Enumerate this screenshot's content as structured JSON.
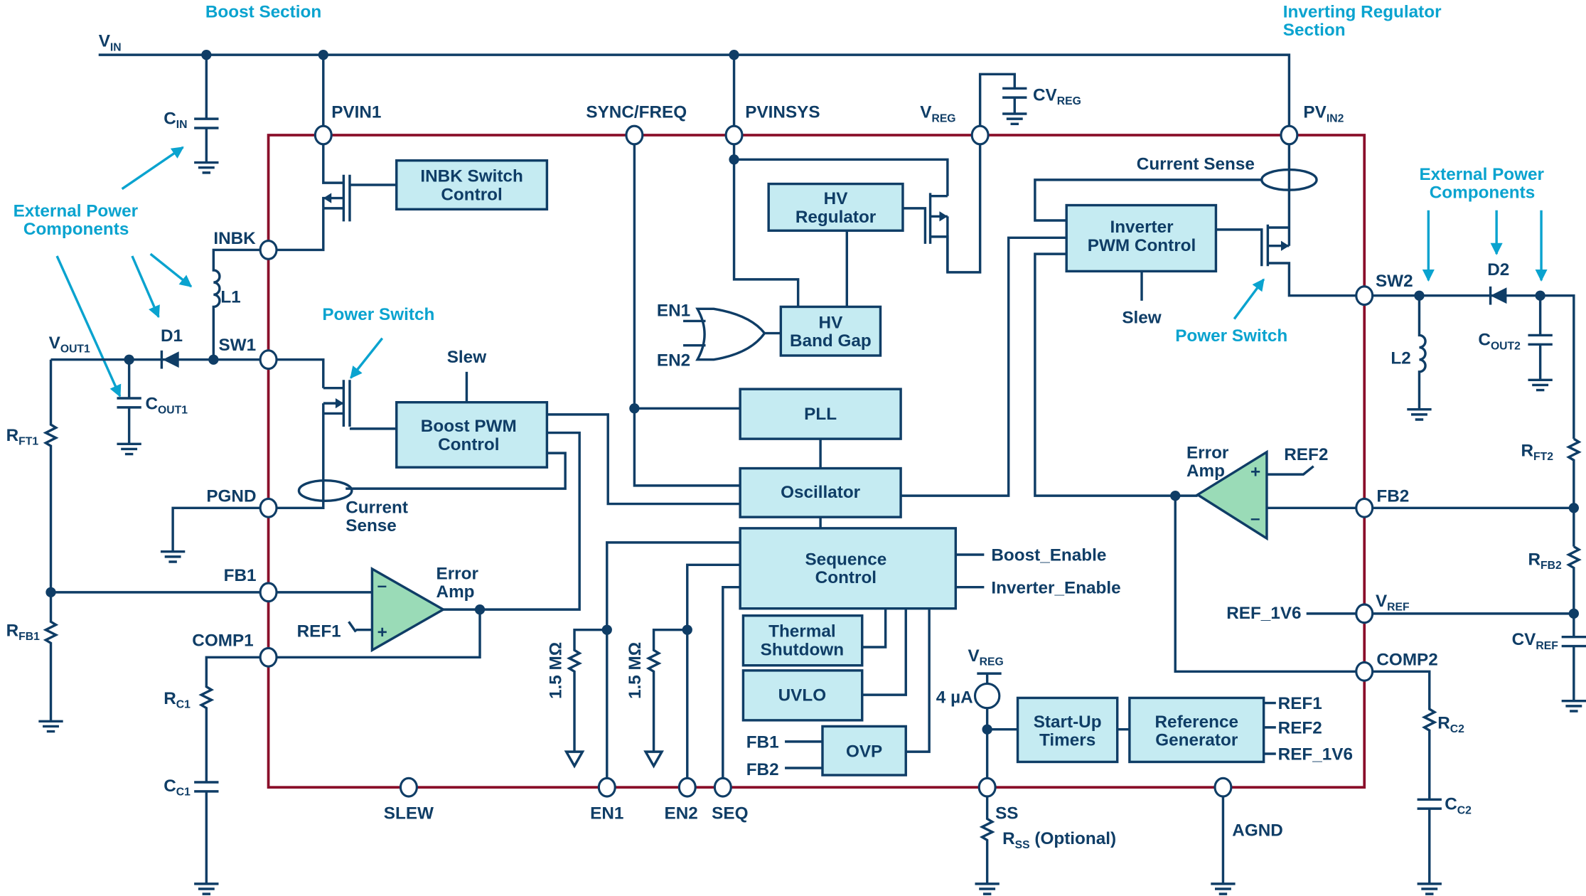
{
  "sections": {
    "boost": "Boost Section",
    "inverting_line1": "Inverting Regulator",
    "inverting_line2": "Section"
  },
  "annotations": {
    "ext_power_left_1": "External Power",
    "ext_power_left_2": "Components",
    "ext_power_right_1": "External Power",
    "ext_power_right_2": "Components",
    "power_switch_left": "Power Switch",
    "power_switch_right": "Power Switch"
  },
  "pins": {
    "pvin1": "PVIN1",
    "sync_freq": "SYNC/FREQ",
    "pvinsys": "PVINSYS",
    "vreg_main": "V",
    "vreg_sub": "REG",
    "pvin2_main": "PV",
    "pvin2_sub": "IN2",
    "inbk": "INBK",
    "sw1": "SW1",
    "pgnd": "PGND",
    "fb1": "FB1",
    "comp1": "COMP1",
    "slew": "SLEW",
    "en1": "EN1",
    "en2": "EN2",
    "seq": "SEQ",
    "ss": "SS",
    "agnd": "AGND",
    "sw2": "SW2",
    "fb2": "FB2",
    "vref_main": "V",
    "vref_sub": "REF",
    "comp2": "COMP2"
  },
  "blocks": {
    "inbk_switch_1": "INBK Switch",
    "inbk_switch_2": "Control",
    "hv_reg_1": "HV",
    "hv_reg_2": "Regulator",
    "hv_bandgap_1": "HV",
    "hv_bandgap_2": "Band Gap",
    "inverter_pwm_1": "Inverter",
    "inverter_pwm_2": "PWM Control",
    "boost_pwm_1": "Boost PWM",
    "boost_pwm_2": "Control",
    "pll": "PLL",
    "oscillator": "Oscillator",
    "sequence_1": "Sequence",
    "sequence_2": "Control",
    "thermal_1": "Thermal",
    "thermal_2": "Shutdown",
    "uvlo": "UVLO",
    "ovp": "OVP",
    "startup_1": "Start-Up",
    "startup_2": "Timers",
    "refgen_1": "Reference",
    "refgen_2": "Generator"
  },
  "labels": {
    "vin_main": "V",
    "vin_sub": "IN",
    "cin_main": "C",
    "cin_sub": "IN",
    "cvreg_main": "CV",
    "cvreg_sub": "REG",
    "l1": "L1",
    "d1": "D1",
    "vout1_main": "V",
    "vout1_sub": "OUT1",
    "cout1_main": "C",
    "cout1_sub": "OUT1",
    "rft1_main": "R",
    "rft1_sub": "FT1",
    "rfb1_main": "R",
    "rfb1_sub": "FB1",
    "rc1_main": "R",
    "rc1_sub": "C1",
    "cc1_main": "C",
    "cc1_sub": "C1",
    "slew_boost": "Slew",
    "slew_inv": "Slew",
    "current_sense_boost_1": "Current",
    "current_sense_boost_2": "Sense",
    "current_sense_inv": "Current Sense",
    "error_amp_1": "Error",
    "error_amp_2": "Amp",
    "ref1": "REF1",
    "ref2": "REF2",
    "en1_gate": "EN1",
    "en2_gate": "EN2",
    "res_en1": "1.5 MΩ",
    "res_en2": "1.5 MΩ",
    "boost_enable": "Boost_Enable",
    "inverter_enable": "Inverter_Enable",
    "ovp_fb1": "FB1",
    "ovp_fb2": "FB2",
    "vreg_src_main": "V",
    "vreg_src_sub": "REG",
    "current_src": "4 µA",
    "rss_main": "R",
    "rss_sub": "SS",
    "rss_opt": " (Optional)",
    "refgen_ref1": "REF1",
    "refgen_ref2": "REF2",
    "refgen_ref1v6": "REF_1V6",
    "ref_1v6_in": "REF_1V6",
    "d2": "D2",
    "l2": "L2",
    "cout2_main": "C",
    "cout2_sub": "OUT2",
    "rft2_main": "R",
    "rft2_sub": "FT2",
    "rfb2_main": "R",
    "rfb2_sub": "FB2",
    "cvref_main": "CV",
    "cvref_sub": "REF",
    "rc2_main": "R",
    "rc2_sub": "C2",
    "cc2_main": "C",
    "cc2_sub": "C2"
  },
  "colors": {
    "wire": "#0f3d66",
    "chip_border": "#8a0f2a",
    "block_fill": "#c5ebf2",
    "amp_fill": "#9adbb7",
    "annotation": "#0aa3cf"
  }
}
